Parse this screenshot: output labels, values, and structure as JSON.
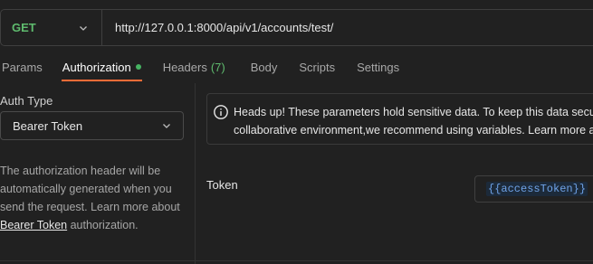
{
  "request": {
    "method": "GET",
    "url": "http://127.0.0.1:8000/api/v1/accounts/test/"
  },
  "tabs": [
    {
      "label": "Params"
    },
    {
      "label": "Authorization"
    },
    {
      "label": "Headers",
      "count": "(7)"
    },
    {
      "label": "Body"
    },
    {
      "label": "Scripts"
    },
    {
      "label": "Settings"
    }
  ],
  "auth": {
    "type_label": "Auth Type",
    "selected_type": "Bearer Token",
    "desc_part1": "The authorization header will be automatically generated when you send the request. Learn more about ",
    "desc_link": "Bearer Token",
    "desc_part2": " authorization."
  },
  "notice": {
    "line1": "Heads up! These parameters hold sensitive data. To keep this data secure while working in a",
    "line2": "collaborative environment,we recommend using variables. Learn more about"
  },
  "token": {
    "label": "Token",
    "value": "{{accessToken}}"
  },
  "colors": {
    "method_get": "#5fbb6e",
    "active_tab_underline": "#ff6c37",
    "status_dot": "#46b362",
    "variable": "#6fa3e8"
  }
}
